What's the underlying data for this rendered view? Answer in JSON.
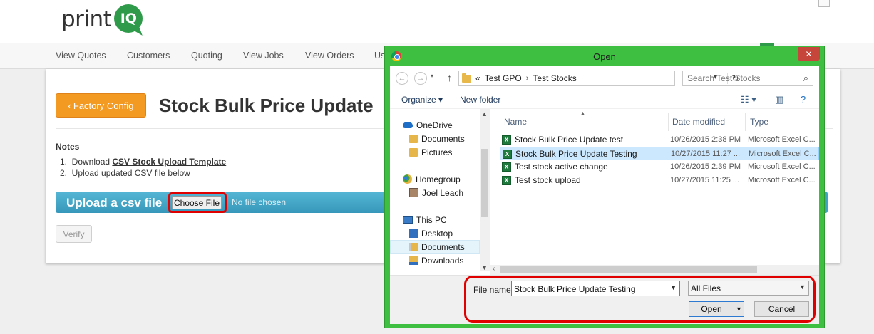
{
  "site": {
    "logo_text": "print",
    "logo_mark": "IQ"
  },
  "nav": {
    "items": [
      "View Quotes",
      "Customers",
      "Quoting",
      "View Jobs",
      "View Orders",
      "Us"
    ]
  },
  "page": {
    "factory_button": "Factory Config",
    "factory_icon": "chevron-left-icon",
    "title": "Stock Bulk Price Update",
    "notes_label": "Notes",
    "note1_prefix": "1.  Download ",
    "note1_link": "CSV Stock Upload Template",
    "note2": "2.  Upload updated CSV file below",
    "upload_label": "Upload a csv file",
    "choose_file": "Choose File",
    "no_file": "No file chosen",
    "verify_button": "Verify"
  },
  "dialog": {
    "title": "Open",
    "close_icon": "✕",
    "address": {
      "chevrons": "«",
      "crumbs": [
        "Test GPO",
        "Test Stocks"
      ]
    },
    "search_placeholder": "Search Test Stocks",
    "toolbar": {
      "organize": "Organize ▾",
      "new_folder": "New folder"
    },
    "nav_pane": [
      {
        "label": "OneDrive",
        "icon": "cloud-icon"
      },
      {
        "label": "Documents",
        "icon": "folder-icon"
      },
      {
        "label": "Pictures",
        "icon": "folder-icon"
      },
      {
        "label": "Homegroup",
        "icon": "homegroup-icon"
      },
      {
        "label": "Joel Leach",
        "icon": "user-icon"
      },
      {
        "label": "This PC",
        "icon": "computer-icon"
      },
      {
        "label": "Desktop",
        "icon": "desktop-icon"
      },
      {
        "label": "Documents",
        "icon": "documents-icon"
      },
      {
        "label": "Downloads",
        "icon": "downloads-icon"
      }
    ],
    "columns": [
      "Name",
      "Date modified",
      "Type"
    ],
    "files": [
      {
        "name": "Stock Bulk Price Update test",
        "date": "10/26/2015 2:38 PM",
        "type": "Microsoft Excel C..."
      },
      {
        "name": "Stock Bulk Price Update Testing",
        "date": "10/27/2015 11:27 ...",
        "type": "Microsoft Excel C..."
      },
      {
        "name": "Test stock active change",
        "date": "10/26/2015 2:39 PM",
        "type": "Microsoft Excel C..."
      },
      {
        "name": "Test stock upload",
        "date": "10/27/2015 11:25 ...",
        "type": "Microsoft Excel C..."
      }
    ],
    "file_name_label": "File name:",
    "file_name_value": "Stock Bulk Price Update Testing",
    "file_type": "All Files",
    "open_button": "Open",
    "cancel_button": "Cancel"
  },
  "colors": {
    "dialog_frame": "#3fbf42",
    "factory_button": "#f39a23",
    "upload_bar": "#3797bb",
    "highlight": "#e00000",
    "selected_file": "#cce8ff"
  }
}
